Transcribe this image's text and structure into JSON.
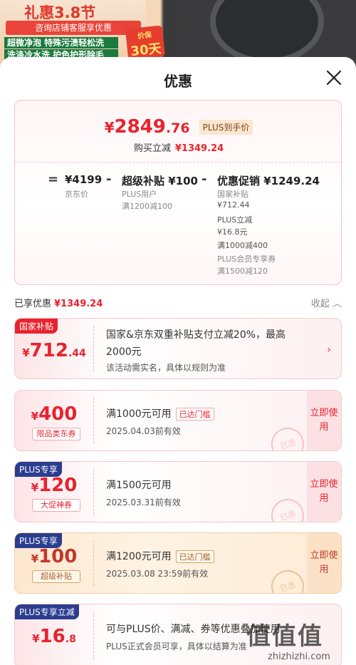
{
  "banner": {
    "promo_title": "礼惠3.8节",
    "promo_sub": "咨询店铺客服享优惠",
    "features": [
      "超微净泡 特殊污渍轻松洗",
      "洗涤冷水洗 护色护形除毛"
    ],
    "badge_small": "价保",
    "badge_big": "30天"
  },
  "sheet": {
    "title": "优惠"
  },
  "summary": {
    "price_currency": "¥",
    "price_int": "2849",
    "price_dec": ".76",
    "plus_tag": "PLUS到手价",
    "subsidy_label": "购买立减",
    "subsidy_amount": "¥1349.24",
    "formula": {
      "eq": "=",
      "jd_price": "¥4199",
      "jd_price_label": "京东价",
      "minus1": "-",
      "super_subsidy": "超级补贴 ¥100",
      "super_sub1": "PLUS用户",
      "super_sub2": "满1200减100",
      "minus2": "-",
      "promo": "优惠促销 ¥1249.24",
      "promo_lines": [
        "国家补贴",
        "¥712.44",
        "PLUS立减",
        "¥16.8元",
        "满1000减400",
        "PLUS会员专享券",
        "满1500减120"
      ]
    }
  },
  "used": {
    "label": "已享优惠",
    "amount": "¥1349.24",
    "collapse": "收起"
  },
  "cards": [
    {
      "tag": "国家补贴",
      "currency": "¥",
      "amount_int": "712",
      "amount_dec": ".44",
      "title": "国家&京东双重补贴支付立减20%，最高",
      "title2": "2000元",
      "desc": "该活动需实名，具体以规则为准"
    },
    {
      "currency": "¥",
      "amount_int": "400",
      "chip": "限品类东券",
      "title": "满1000元可用",
      "reached": "已达门槛",
      "date": "2025.04.03前有效",
      "use": "立即使用",
      "stamp": "已选"
    },
    {
      "tag": "PLUS专享",
      "currency": "¥",
      "amount_int": "120",
      "chip": "大促神券",
      "title": "满1500元可用",
      "date": "2025.03.31前有效",
      "use": "立即使用",
      "stamp": "已选"
    },
    {
      "tag": "PLUS专享",
      "currency": "¥",
      "amount_int": "100",
      "chip": "超级补贴",
      "title": "满1200元可用",
      "reached": "已达门槛",
      "date": "2025.03.08 23:59前有效",
      "use": "立即使用",
      "stamp": "已选"
    },
    {
      "tag": "PLUS专享立减",
      "currency": "¥",
      "amount_int": "16",
      "amount_dec": ".8",
      "title": "可与PLUS价、满减、券等优惠叠加使用",
      "desc": "PLUS正式会员可享，具体以结算为准"
    }
  ],
  "watermark": {
    "logo": "值值值",
    "url": "zhizhizhi.com"
  },
  "colors": {
    "accent": "#e8232e",
    "plus_blue": "#2a3d8f",
    "gold": "#fbe2c6"
  }
}
